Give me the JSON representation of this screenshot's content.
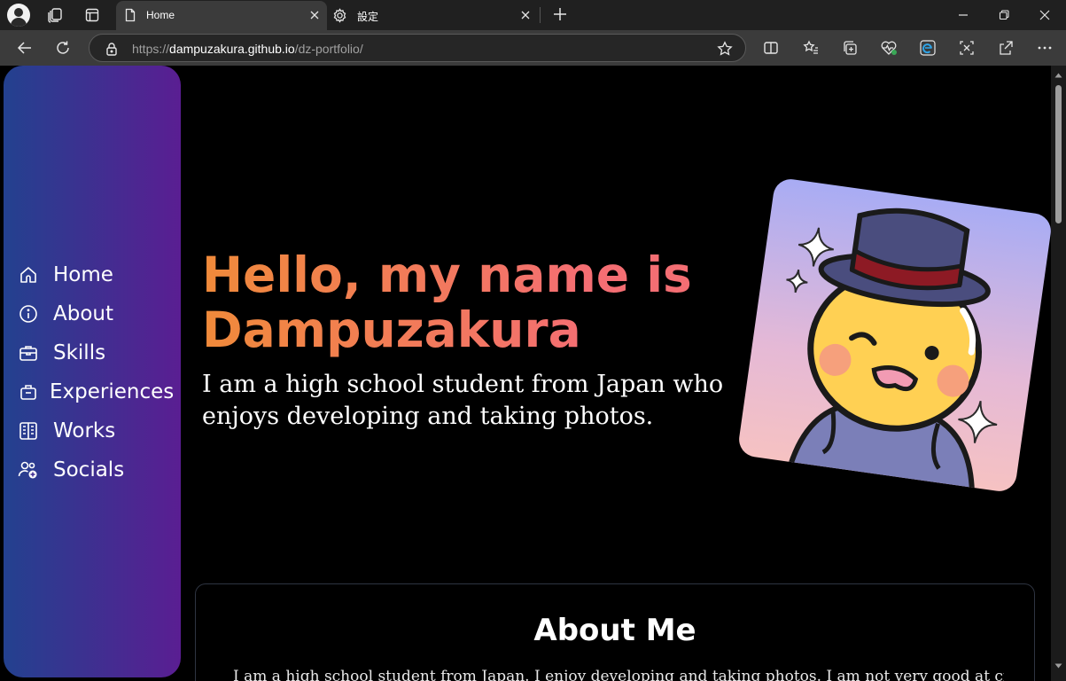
{
  "browser": {
    "tabs": [
      {
        "title": "Home",
        "icon": "page-icon",
        "active": true
      },
      {
        "title": "設定",
        "icon": "gear-icon",
        "active": false
      }
    ],
    "url_prefix": "https://",
    "url_host": "dampuzakura.github.io",
    "url_path": "/dz-portfolio/"
  },
  "sidebar": {
    "items": [
      {
        "label": "Home",
        "icon": "home-icon"
      },
      {
        "label": "About",
        "icon": "info-icon"
      },
      {
        "label": "Skills",
        "icon": "briefcase-icon"
      },
      {
        "label": "Experiences",
        "icon": "suitcase-icon"
      },
      {
        "label": "Works",
        "icon": "works-icon"
      },
      {
        "label": "Socials",
        "icon": "people-add-icon"
      }
    ]
  },
  "hero": {
    "title": "Hello, my name is Dampuzakura",
    "subtitle": "I am a high school student from Japan who enjoys developing and taking photos."
  },
  "about": {
    "heading": "About Me",
    "text": "I am a high school student from Japan. I enjoy developing and taking photos. I am not very good at creating"
  },
  "colors": {
    "sidebar_start": "#23418f",
    "sidebar_end": "#5a1e92",
    "hero_title": "#f17a47",
    "page_bg": "#000000"
  }
}
